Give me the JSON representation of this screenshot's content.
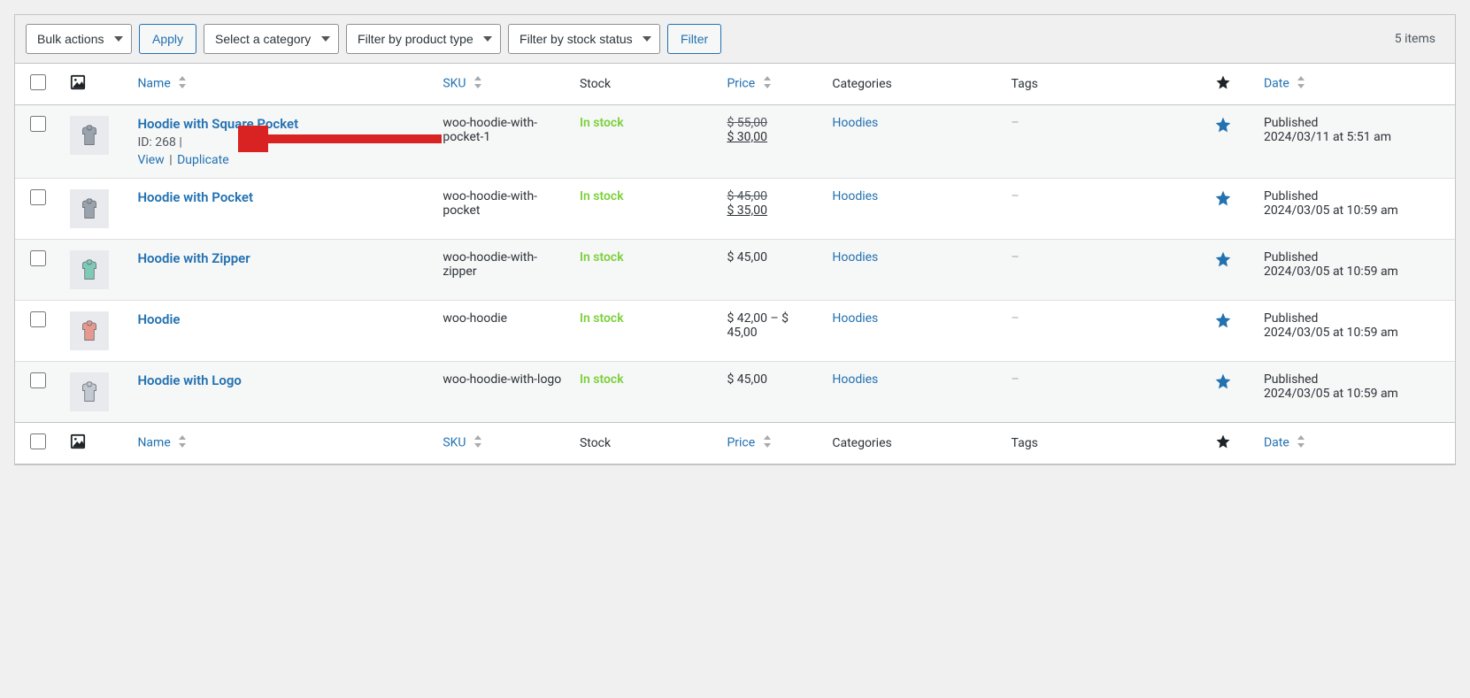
{
  "toolbar": {
    "bulk_actions": "Bulk actions",
    "apply": "Apply",
    "category": "Select a category",
    "product_type": "Filter by product type",
    "stock_status": "Filter by stock status",
    "filter": "Filter",
    "items_count": "5 items"
  },
  "columns": {
    "name": "Name",
    "sku": "SKU",
    "stock": "Stock",
    "price": "Price",
    "categories": "Categories",
    "tags": "Tags",
    "date": "Date"
  },
  "rows": [
    {
      "name": "Hoodie with Square Pocket",
      "id_label": "ID: 268",
      "actions": {
        "view": "View",
        "duplicate": "Duplicate"
      },
      "sku": "woo-hoodie-with-pocket-1",
      "stock": "In stock",
      "price_strike": "$ 55,00",
      "price_sale": "$ 30,00",
      "price_plain": "",
      "category": "Hoodies",
      "tags": "–",
      "date_status": "Published",
      "date_value": "2024/03/11 at 5:51 am",
      "thumb_color": "#9aa3ab",
      "show_actions": true
    },
    {
      "name": "Hoodie with Pocket",
      "sku": "woo-hoodie-with-pocket",
      "stock": "In stock",
      "price_strike": "$ 45,00",
      "price_sale": "$ 35,00",
      "price_plain": "",
      "category": "Hoodies",
      "tags": "–",
      "date_status": "Published",
      "date_value": "2024/03/05 at 10:59 am",
      "thumb_color": "#9aa3ab",
      "show_actions": false
    },
    {
      "name": "Hoodie with Zipper",
      "sku": "woo-hoodie-with-zipper",
      "stock": "In stock",
      "price_strike": "",
      "price_sale": "",
      "price_plain": "$ 45,00",
      "category": "Hoodies",
      "tags": "–",
      "date_status": "Published",
      "date_value": "2024/03/05 at 10:59 am",
      "thumb_color": "#7fc9b8",
      "show_actions": false
    },
    {
      "name": "Hoodie",
      "sku": "woo-hoodie",
      "stock": "In stock",
      "price_strike": "",
      "price_sale": "",
      "price_plain": "$ 42,00 – $ 45,00",
      "category": "Hoodies",
      "tags": "–",
      "date_status": "Published",
      "date_value": "2024/03/05 at 10:59 am",
      "thumb_color": "#e69a8f",
      "show_actions": false
    },
    {
      "name": "Hoodie with Logo",
      "sku": "woo-hoodie-with-logo",
      "stock": "In stock",
      "price_strike": "",
      "price_sale": "",
      "price_plain": "$ 45,00",
      "category": "Hoodies",
      "tags": "–",
      "date_status": "Published",
      "date_value": "2024/03/05 at 10:59 am",
      "thumb_color": "#c2c9d1",
      "show_actions": false
    }
  ]
}
